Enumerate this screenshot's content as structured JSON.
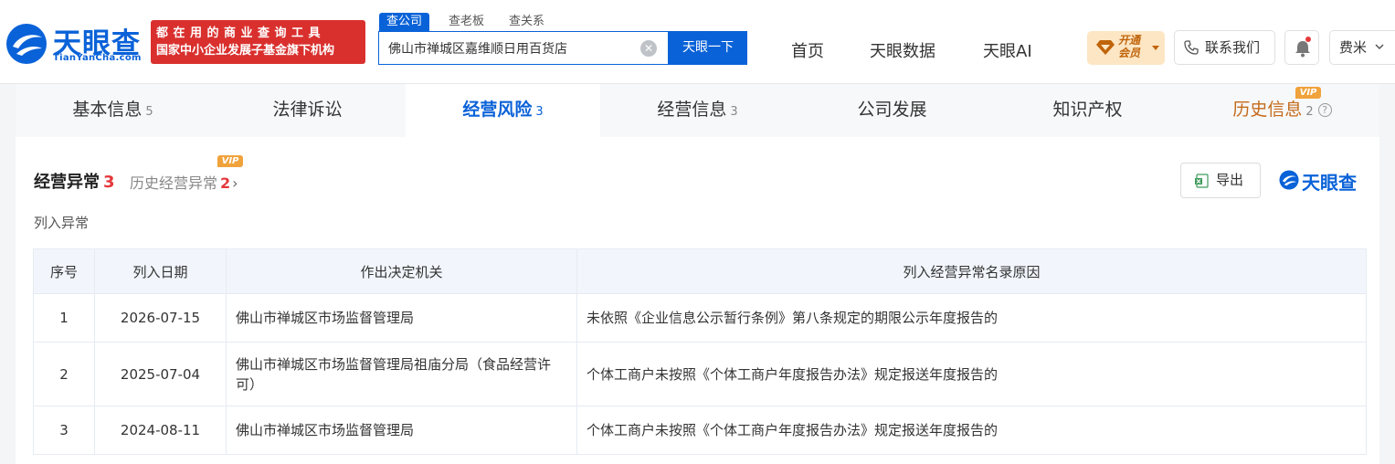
{
  "header": {
    "logo_text": "天眼查",
    "logo_sub": "TianYanCha.com",
    "slogan_line1": "都在用的商业查询工具",
    "slogan_line2": "国家中小企业发展子基金旗下机构",
    "search_tabs": [
      "查公司",
      "查老板",
      "查关系"
    ],
    "search_value": "佛山市禅城区嘉维顺日用百货店",
    "search_button": "天眼一下",
    "nav": [
      "首页",
      "天眼数据",
      "天眼AI"
    ],
    "vip_label": "开通会员",
    "contact_label": "联系我们",
    "user_name": "费米"
  },
  "tabs": [
    {
      "label": "基本信息",
      "count": "5"
    },
    {
      "label": "法律诉讼",
      "count": ""
    },
    {
      "label": "经营风险",
      "count": "3"
    },
    {
      "label": "经营信息",
      "count": "3"
    },
    {
      "label": "公司发展",
      "count": ""
    },
    {
      "label": "知识产权",
      "count": ""
    },
    {
      "label": "历史信息",
      "count": "2"
    }
  ],
  "vip_tag": "VIP",
  "section": {
    "title": "经营异常",
    "count": "3",
    "history_label": "历史经营异常",
    "history_count": "2",
    "export_label": "导出",
    "brand": "天眼查",
    "subtitle": "列入异常"
  },
  "table": {
    "headers": [
      "序号",
      "列入日期",
      "作出决定机关",
      "列入经营异常名录原因"
    ],
    "rows": [
      {
        "no": "1",
        "date": "2026-07-15",
        "org": "佛山市禅城区市场监督管理局",
        "reason": "未依照《企业信息公示暂行条例》第八条规定的期限公示年度报告的"
      },
      {
        "no": "2",
        "date": "2025-07-04",
        "org": "佛山市禅城区市场监督管理局祖庙分局（食品经营许可）",
        "reason": "个体工商户未按照《个体工商户年度报告办法》规定报送年度报告的"
      },
      {
        "no": "3",
        "date": "2024-08-11",
        "org": "佛山市禅城区市场监督管理局",
        "reason": "个体工商户未按照《个体工商户年度报告办法》规定报送年度报告的"
      }
    ]
  },
  "colors": {
    "brand_blue": "#0a62d8",
    "slogan_red": "#d9302e",
    "count_red": "#e4393c",
    "history_orange": "#c46a19",
    "vip_gold": "#f0a23b"
  }
}
